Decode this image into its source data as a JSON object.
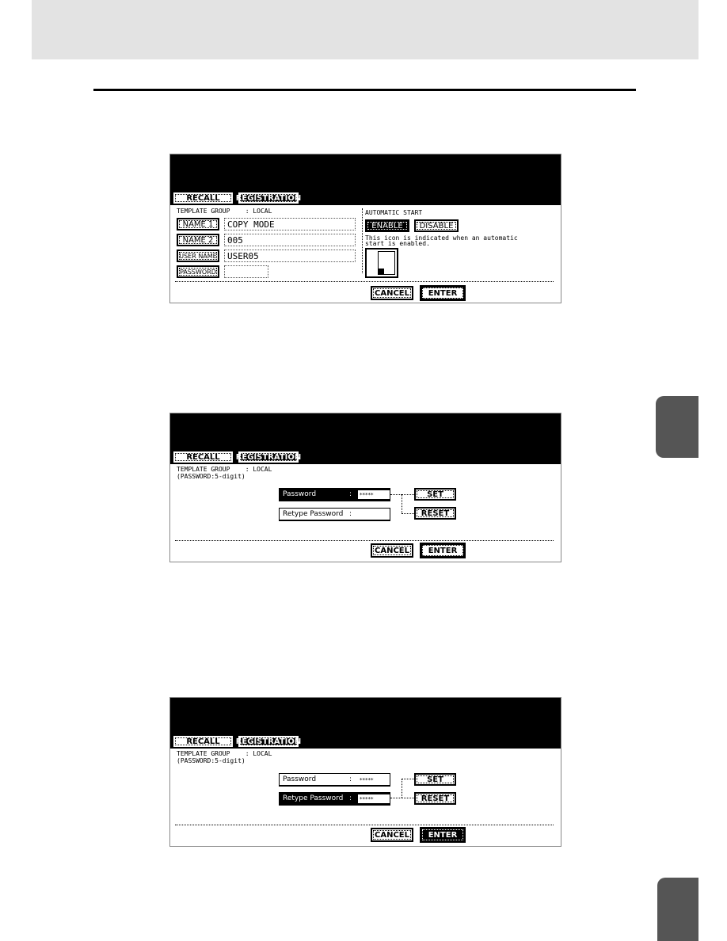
{
  "tabs": {
    "recall": "RECALL",
    "registration": "REGISTRATION"
  },
  "screen1": {
    "template_group": "TEMPLATE GROUP    : LOCAL",
    "name1_label": "NAME 1",
    "name1_value": "COPY MODE",
    "name2_label": "NAME 2",
    "name2_value": "005",
    "user_label": "USER NAME",
    "user_value": "USER05",
    "password_label": "PASSWORD",
    "password_value": "",
    "auto_start": "AUTOMATIC START",
    "enable": "ENABLE",
    "disable": "DISABLE",
    "note": "This icon is indicated when an automatic\nstart is enabled.",
    "cancel": "CANCEL",
    "enter": "ENTER"
  },
  "screen2": {
    "template_group": "TEMPLATE GROUP    : LOCAL\n(PASSWORD:5-digit)",
    "password_label": "Password",
    "password_value": "*****",
    "retype_label": "Retype Password",
    "retype_value": "",
    "colon": ":",
    "set": "SET",
    "reset": "RESET",
    "cancel": "CANCEL",
    "enter": "ENTER"
  },
  "screen3": {
    "template_group": "TEMPLATE GROUP    : LOCAL\n(PASSWORD:5-digit)",
    "password_label": "Password",
    "password_value": "*****",
    "retype_label": "Retype Password",
    "retype_value": "*****",
    "colon": ":",
    "set": "SET",
    "reset": "RESET",
    "cancel": "CANCEL",
    "enter": "ENTER"
  }
}
